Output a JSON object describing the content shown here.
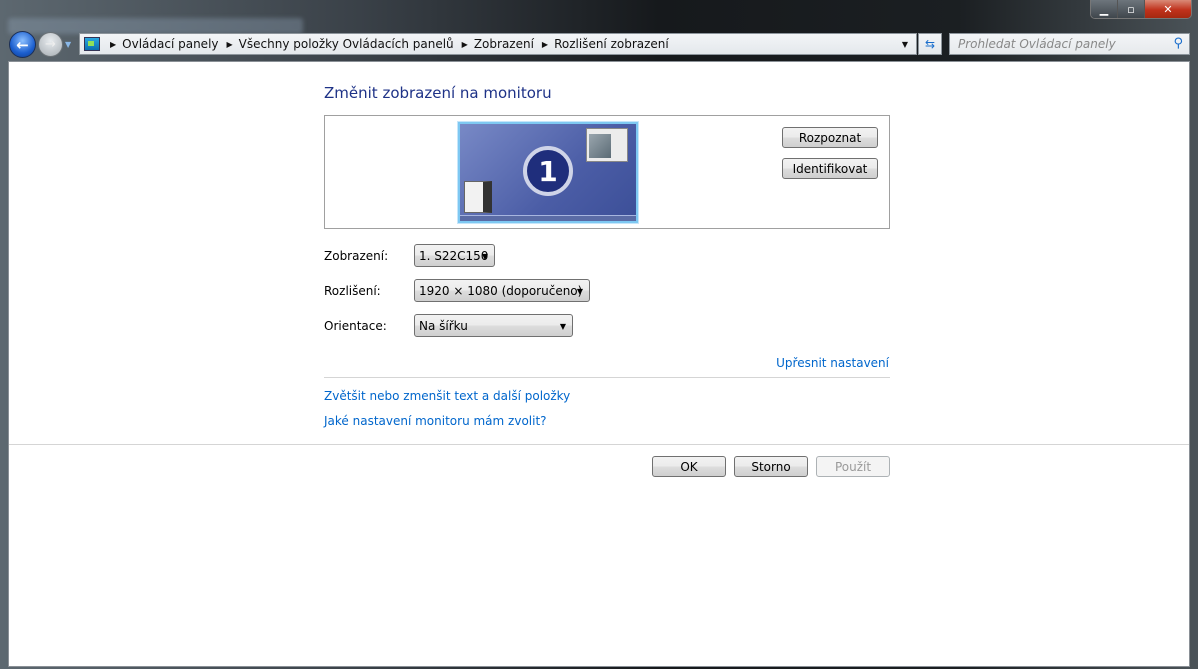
{
  "window": {
    "minimize": "minimize",
    "maximize": "maximize",
    "close": "close"
  },
  "address_bar": {
    "breadcrumbs": [
      "Ovládací panely",
      "Všechny položky Ovládacích panelů",
      "Zobrazení",
      "Rozlišení zobrazení"
    ]
  },
  "search": {
    "placeholder": "Prohledat Ovládací panely"
  },
  "main": {
    "title": "Změnit zobrazení na monitoru",
    "monitor_number": "1",
    "detect_button": "Rozpoznat",
    "identify_button": "Identifikovat",
    "display_label": "Zobrazení:",
    "display_value": "1. S22C150",
    "resolution_label": "Rozlišení:",
    "resolution_value": "1920 × 1080 (doporučeno)",
    "orientation_label": "Orientace:",
    "orientation_value": "Na šířku",
    "advanced_link": "Upřesnit nastavení",
    "link_text_size": "Zvětšit nebo zmenšit text a další položky",
    "link_which_settings": "Jaké nastavení monitoru mám zvolit?"
  },
  "footer": {
    "ok": "OK",
    "cancel": "Storno",
    "apply": "Použít"
  }
}
